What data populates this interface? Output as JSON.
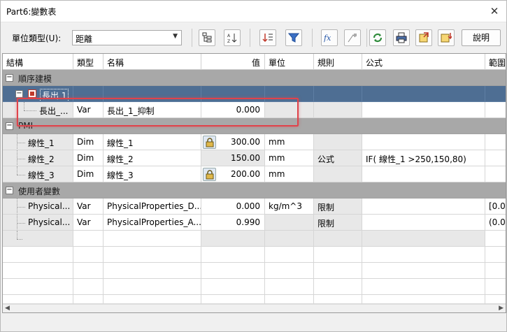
{
  "window": {
    "title": "Part6:變數表",
    "close_glyph": "✕"
  },
  "toolbar": {
    "unit_type_label": "單位類型(U):",
    "unit_type_value": "距離",
    "help_label": "說明",
    "buttons": [
      "tree-view-icon",
      "sort-icon",
      "insert-row-icon",
      "filter-icon",
      "fx-icon",
      "rebuild-icon",
      "regenerate-icon",
      "print-icon",
      "export-icon",
      "import-icon"
    ]
  },
  "columns": {
    "structure": "結構",
    "type": "類型",
    "name": "名稱",
    "value": "值",
    "unit": "單位",
    "rule": "規則",
    "formula": "公式",
    "range": "範圍"
  },
  "rows": {
    "g1": {
      "label": "順序建模"
    },
    "s1": {
      "label": "長出 1"
    },
    "r1": {
      "structure": "長出_...",
      "type": "Var",
      "name": "長出_1_抑制",
      "value": "0.000",
      "unit": "",
      "rule": "",
      "formula": "",
      "range": ""
    },
    "g2": {
      "label": "PMI"
    },
    "r2": {
      "structure": "線性_1",
      "type": "Dim",
      "name": "線性_1",
      "value": "300.00",
      "unit": "mm",
      "rule": "",
      "formula": "",
      "range": ""
    },
    "r3": {
      "structure": "線性_2",
      "type": "Dim",
      "name": "線性_2",
      "value": "150.00",
      "unit": "mm",
      "rule": "公式",
      "formula": "IF( 線性_1 >250,150,80)",
      "range": ""
    },
    "r4": {
      "structure": "線性_3",
      "type": "Dim",
      "name": "線性_3",
      "value": "200.00",
      "unit": "mm",
      "rule": "",
      "formula": "",
      "range": ""
    },
    "g3": {
      "label": "使用者變數"
    },
    "r5": {
      "structure": "Physical...",
      "type": "Var",
      "name": "PhysicalProperties_D...",
      "value": "0.000",
      "unit": "kg/m^3",
      "rule": "限制",
      "formula": "",
      "range": "[0.0"
    },
    "r6": {
      "structure": "Physical...",
      "type": "Var",
      "name": "PhysicalProperties_A...",
      "value": "0.990",
      "unit": "",
      "rule": "限制",
      "formula": "",
      "range": "(0.0"
    }
  },
  "colors": {
    "group_row": "#a8a8a8",
    "selected_row": "#4e6e93",
    "highlight_box": "#e0434b"
  }
}
